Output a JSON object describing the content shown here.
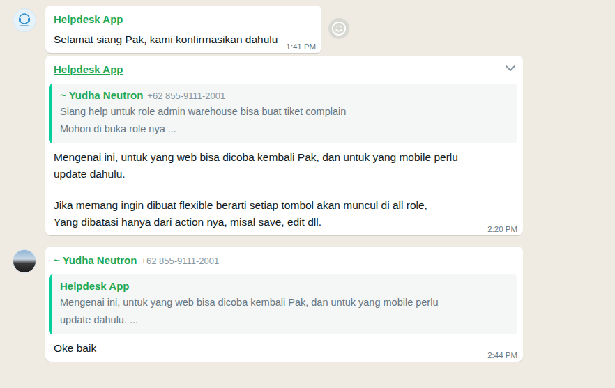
{
  "messages": [
    {
      "show_avatar": true,
      "avatar_kind": "logo",
      "sender": "Helpdesk App",
      "hovered": false,
      "reaction_button": true,
      "paragraphs": [
        [
          "Selamat siang Pak, kami konfirmasikan dahulu"
        ]
      ],
      "time": "1:41 PM"
    },
    {
      "show_avatar": false,
      "sender": "Helpdesk App",
      "hovered": true,
      "reaction_button": false,
      "quote": {
        "sender": "~ Yudha Neutron",
        "phone": "+62 855-9111-2001",
        "lines": [
          "Siang help untuk role admin warehouse bisa buat tiket complain",
          "Mohon di buka role nya ..."
        ]
      },
      "paragraphs": [
        [
          "Mengenai ini, untuk yang web bisa dicoba kembali Pak, dan untuk yang mobile perlu",
          "update dahulu."
        ],
        [
          "Jika memang ingin dibuat flexible berarti setiap tombol akan muncul di all role,",
          "Yang dibatasi hanya dari action nya, misal save, edit dll."
        ]
      ],
      "time": "2:20 PM"
    },
    {
      "show_avatar": true,
      "avatar_kind": "photo",
      "sender": "~ Yudha Neutron",
      "phone": "+62 855-9111-2001",
      "hovered": false,
      "reaction_button": false,
      "quote": {
        "sender": "Helpdesk App",
        "lines": [
          "Mengenai ini, untuk yang web bisa dicoba kembali Pak, dan untuk yang mobile perlu",
          "update dahulu. ..."
        ]
      },
      "paragraphs": [
        [
          "Oke baik"
        ]
      ],
      "time": "2:44 PM"
    }
  ]
}
